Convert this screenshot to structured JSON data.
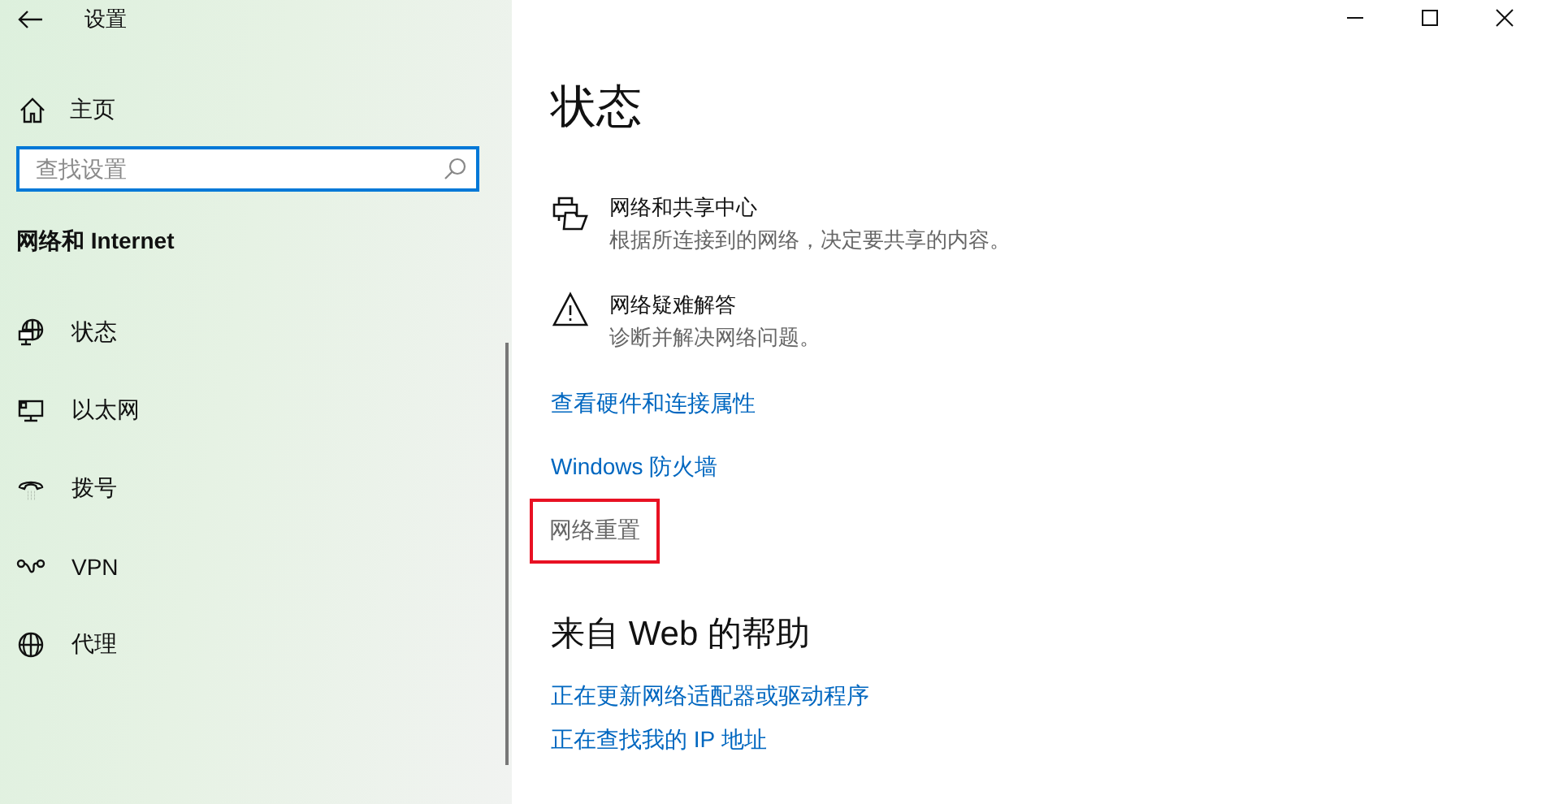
{
  "window": {
    "title": "设置",
    "controls": [
      {
        "kind": "minimize"
      },
      {
        "kind": "maximize"
      },
      {
        "kind": "close"
      }
    ]
  },
  "sidebar": {
    "home": "主页",
    "search": {
      "placeholder": "查找设置"
    },
    "section": "网络和 Internet",
    "items": [
      {
        "label": "状态",
        "kind": "status"
      },
      {
        "label": "以太网",
        "kind": "ethernet"
      },
      {
        "label": "拨号",
        "kind": "dialup"
      },
      {
        "label": "VPN",
        "kind": "vpn"
      },
      {
        "label": "代理",
        "kind": "proxy"
      }
    ]
  },
  "content": {
    "title": "状态",
    "actions": [
      {
        "kind": "sharing",
        "title": "网络和共享中心",
        "description": "根据所连接到的网络，决定要共享的内容。"
      },
      {
        "kind": "warning",
        "title": "网络疑难解答",
        "description": "诊断并解决网络问题。"
      }
    ],
    "links": [
      {
        "label": "查看硬件和连接属性",
        "kind": "link",
        "highlighted": false
      },
      {
        "label": "Windows 防火墙",
        "kind": "link",
        "highlighted": false
      },
      {
        "label": "网络重置",
        "kind": "plain",
        "highlighted": true
      }
    ],
    "help": {
      "title": "来自 Web 的帮助",
      "links": [
        "正在更新网络适配器或驱动程序",
        "正在查找我的 IP 地址"
      ]
    }
  }
}
